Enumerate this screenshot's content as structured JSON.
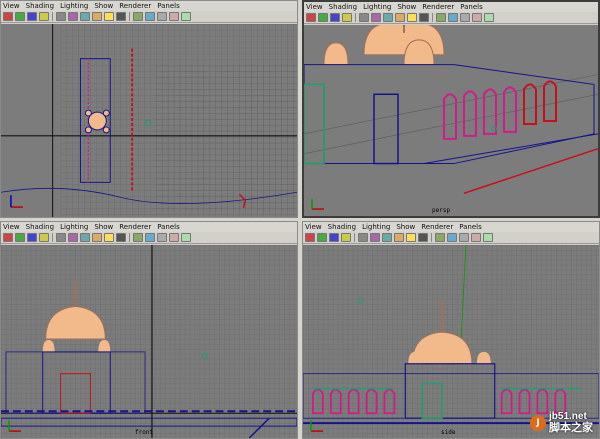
{
  "viewports": {
    "top": {
      "menus": [
        "View",
        "Shading",
        "Lighting",
        "Show",
        "Renderer",
        "Panels"
      ],
      "camera": ""
    },
    "persp": {
      "menus": [
        "View",
        "Shading",
        "Lighting",
        "Show",
        "Renderer",
        "Panels"
      ],
      "camera": "persp"
    },
    "front": {
      "menus": [
        "View",
        "Shading",
        "Lighting",
        "Show",
        "Renderer",
        "Panels"
      ],
      "camera": "front"
    },
    "side": {
      "menus": [
        "View",
        "Shading",
        "Lighting",
        "Show",
        "Renderer",
        "Panels"
      ],
      "camera": "side"
    }
  },
  "toolbar_icons": [
    "camera-icon",
    "camera-attr-icon",
    "bookmark-icon",
    "image-plane-icon",
    "grid-icon",
    "wireframe-icon",
    "smooth-shade-icon",
    "texture-icon",
    "light-icon",
    "shadow-icon",
    "isolate-icon",
    "xray-icon",
    "resolution-gate-icon",
    "film-gate-icon",
    "safe-action-icon"
  ],
  "colors": {
    "grid": "#7c7c7c",
    "grid_line": "#5a5a5a",
    "wire_blue": "#14148c",
    "dome": "#f2b98a",
    "arch_magenta": "#d21a8c",
    "arch_green": "#1aa068",
    "pillar_red": "#c8101c",
    "axis_x": "#c00000",
    "axis_y": "#00a000",
    "axis_z": "#0000c0"
  },
  "watermark": {
    "logo": "J",
    "url": "jb51.net",
    "text": "脚本之家"
  }
}
